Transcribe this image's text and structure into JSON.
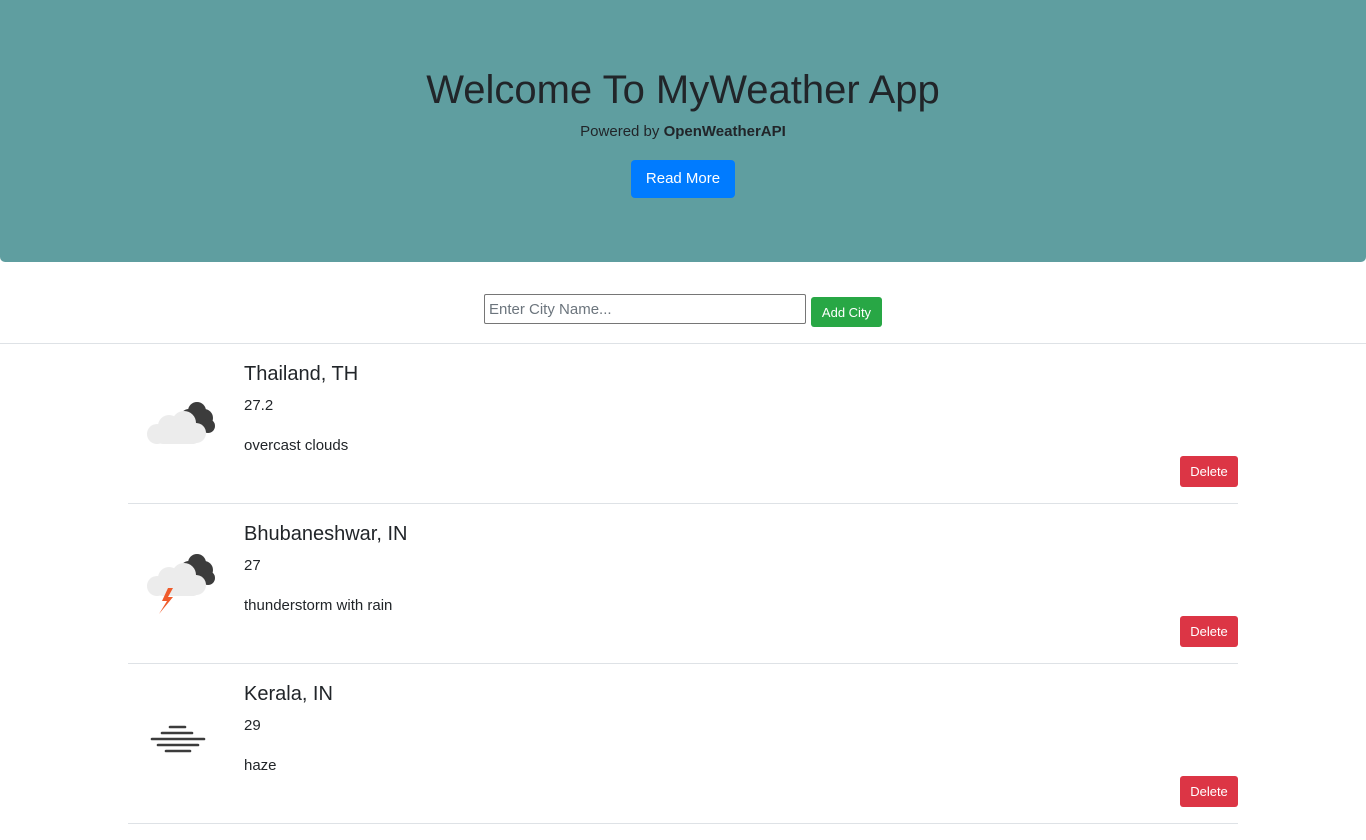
{
  "hero": {
    "title": "Welcome To MyWeather App",
    "powered_prefix": "Powered by",
    "powered_brand": "OpenWeatherAPI",
    "read_more_label": "Read More"
  },
  "form": {
    "placeholder": "Enter City Name...",
    "value": "",
    "add_label": "Add City"
  },
  "cities": [
    {
      "name": "Thailand, TH",
      "temp": "27.2",
      "description": "overcast clouds",
      "icon": "overcast-clouds-icon",
      "delete_label": "Delete"
    },
    {
      "name": "Bhubaneshwar, IN",
      "temp": "27",
      "description": "thunderstorm with rain",
      "icon": "thunderstorm-icon",
      "delete_label": "Delete"
    },
    {
      "name": "Kerala, IN",
      "temp": "29",
      "description": "haze",
      "icon": "haze-icon",
      "delete_label": "Delete"
    }
  ],
  "colors": {
    "hero_bg": "#5f9ea0",
    "primary": "#007bff",
    "success": "#28a745",
    "danger": "#dc3545"
  }
}
